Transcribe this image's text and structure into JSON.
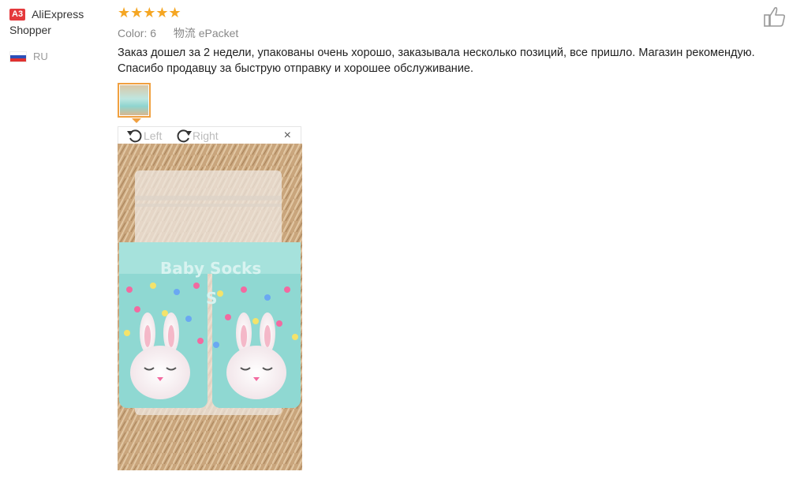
{
  "reviewer": {
    "badge": "A3",
    "name": "AliExpress Shopper",
    "country_code": "RU"
  },
  "rating": {
    "stars": 5,
    "max": 5,
    "glyphs": "★★★★★"
  },
  "meta": {
    "color_label": "Color:",
    "color_value": "6",
    "shipping_label": "物流",
    "shipping_value": "ePacket"
  },
  "review_text": "Заказ дошел за 2 недели, упакованы очень хорошо, заказывала несколько позиций, все пришло. Магазин рекомендую. Спасибо продавцу за быструю отправку и хорошее обслуживание.",
  "viewer": {
    "rotate_left_label": "Left",
    "rotate_right_label": "Right",
    "close_glyph": "×"
  },
  "product_image_text": {
    "line1": "Baby Socks",
    "line2": "S"
  },
  "icons": {
    "like": "thumbs-up-icon",
    "rotate_left": "rotate-left-icon",
    "rotate_right": "rotate-right-icon",
    "close": "close-icon",
    "flag": "russia-flag-icon"
  },
  "colors": {
    "accent": "#f0a040",
    "star": "#f5a623",
    "badge": "#e4393c",
    "sock": "#8fd8d2"
  }
}
